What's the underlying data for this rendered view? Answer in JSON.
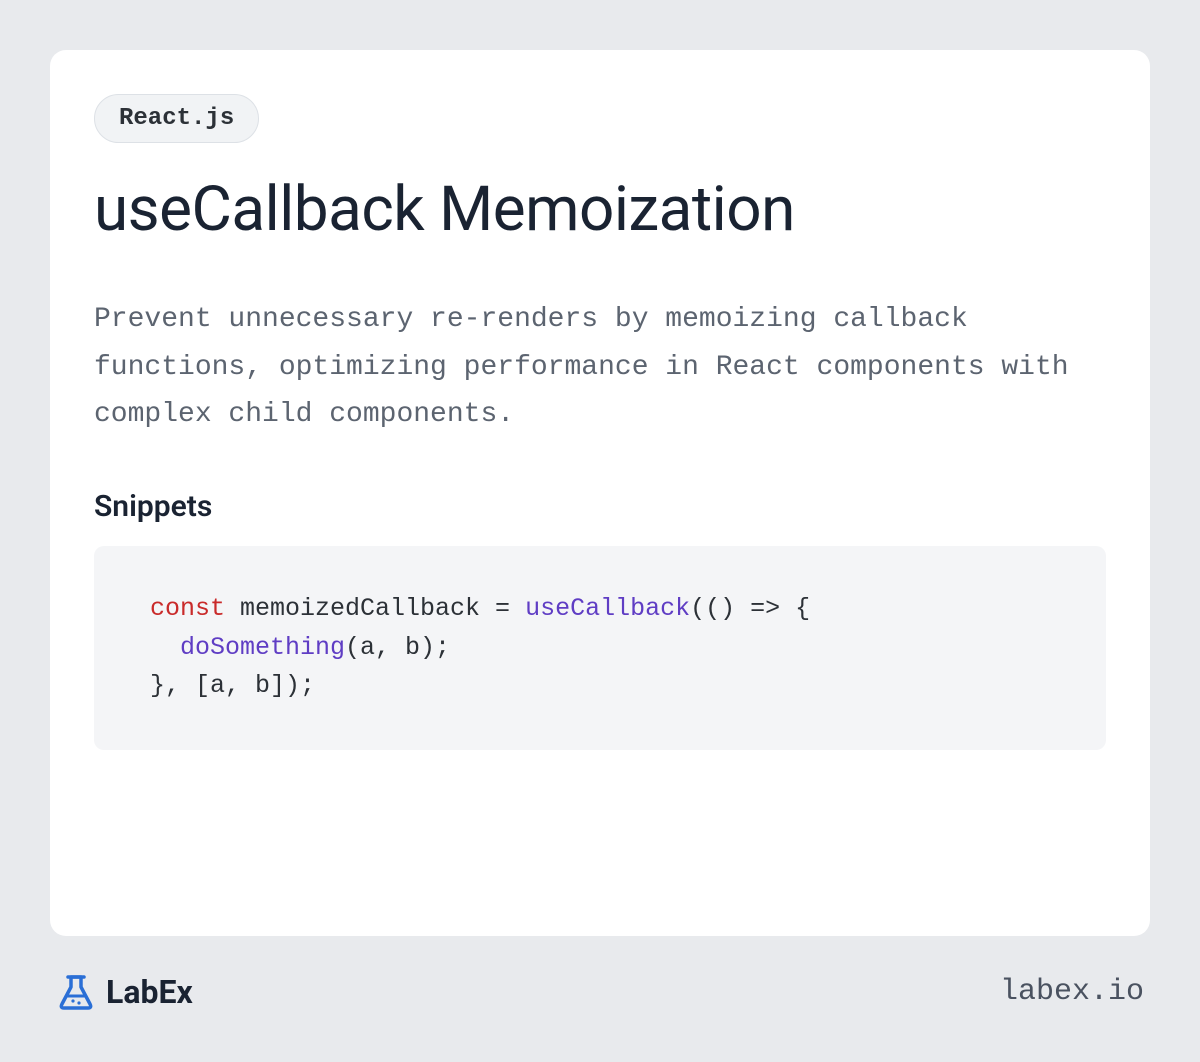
{
  "tag": "React.js",
  "title": "useCallback Memoization",
  "description": "Prevent unnecessary re-renders by memoizing callback functions, optimizing performance in React components with complex child components.",
  "section_heading": "Snippets",
  "code": {
    "tokens": [
      {
        "t": "const ",
        "c": "keyword"
      },
      {
        "t": "memoizedCallback = ",
        "c": "text"
      },
      {
        "t": "useCallback",
        "c": "function"
      },
      {
        "t": "(() => {\n  ",
        "c": "text"
      },
      {
        "t": "doSomething",
        "c": "function"
      },
      {
        "t": "(a, b);\n}, [a, b]);",
        "c": "text"
      }
    ]
  },
  "footer": {
    "brand_name": "LabEx",
    "site_url": "labex.io"
  },
  "colors": {
    "page_bg": "#e8eaed",
    "card_bg": "#ffffff",
    "tag_bg": "#f1f3f5",
    "code_bg": "#f4f5f7",
    "text_primary": "#1a2332",
    "text_secondary": "#5c6470",
    "keyword": "#c92a2a",
    "function": "#5f3dc4",
    "logo_accent": "#2a6fd6"
  }
}
